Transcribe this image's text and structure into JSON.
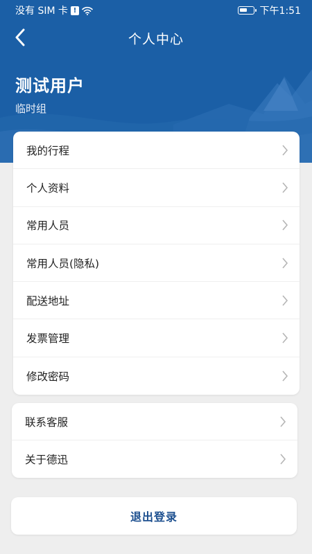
{
  "status_bar": {
    "carrier": "没有 SIM 卡",
    "alert_glyph": "!",
    "time": "下午1:51"
  },
  "nav": {
    "title": "个人中心"
  },
  "profile": {
    "name": "测试用户",
    "group": "临时组"
  },
  "menu_main": [
    {
      "label": "我的行程"
    },
    {
      "label": "个人资料"
    },
    {
      "label": "常用人员"
    },
    {
      "label": "常用人员(隐私)"
    },
    {
      "label": "配送地址"
    },
    {
      "label": "发票管理"
    },
    {
      "label": "修改密码"
    }
  ],
  "menu_secondary": [
    {
      "label": "联系客服"
    },
    {
      "label": "关于德迅"
    }
  ],
  "logout_label": "退出登录",
  "colors": {
    "header": "#1b5fa6",
    "accent_text": "#1c4f8f",
    "background": "#eeeeee"
  }
}
